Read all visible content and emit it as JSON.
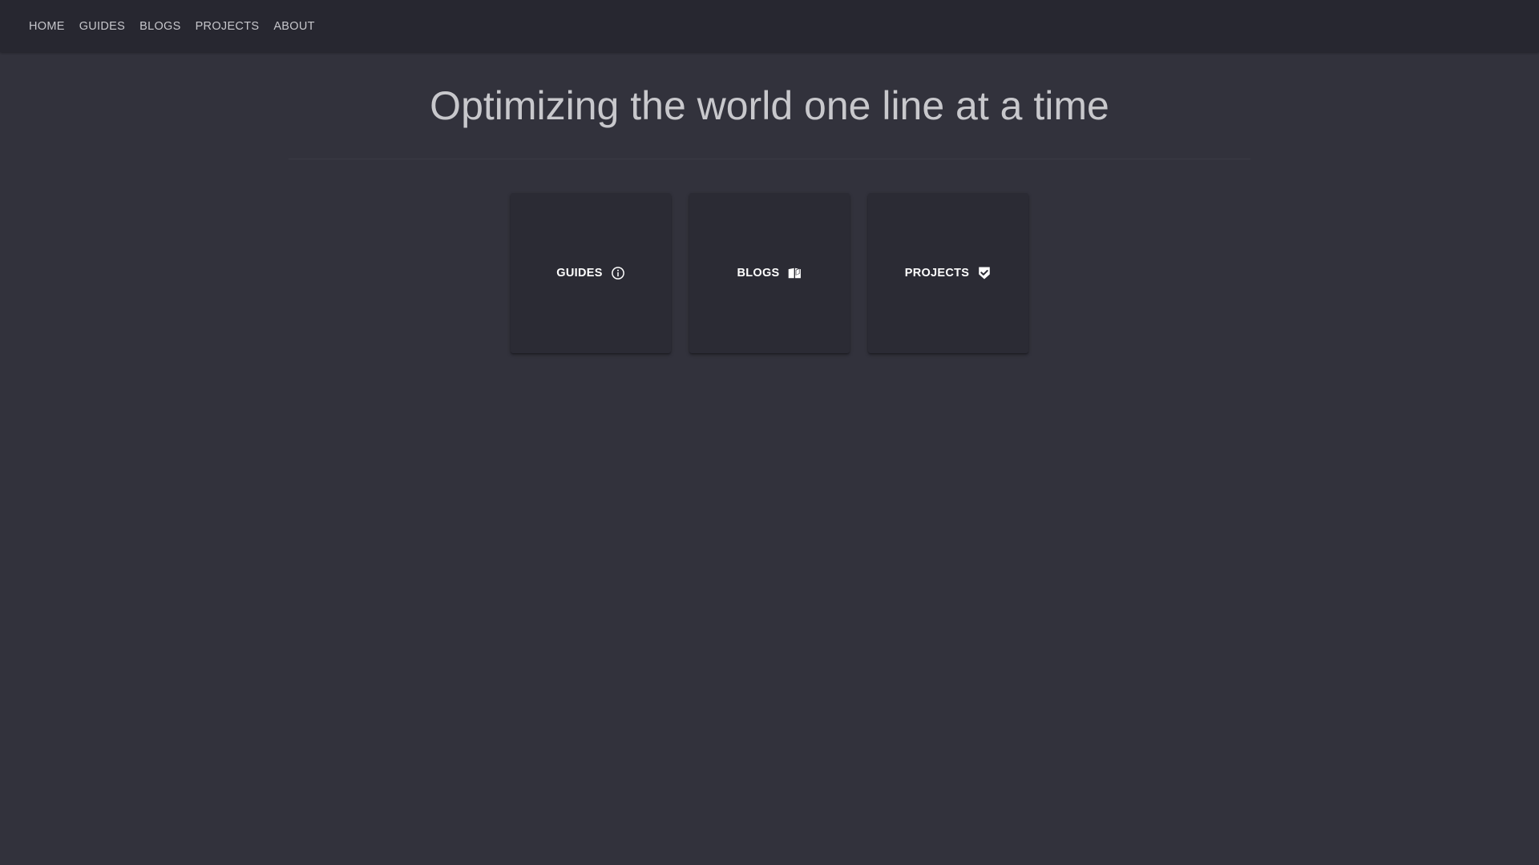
{
  "nav": {
    "items": [
      {
        "label": "HOME"
      },
      {
        "label": "GUIDES"
      },
      {
        "label": "BLOGS"
      },
      {
        "label": "PROJECTS"
      },
      {
        "label": "ABOUT"
      }
    ]
  },
  "hero": {
    "title": "Optimizing the world one line at a time"
  },
  "cards": [
    {
      "label": "GUIDES",
      "icon": "info-circle-icon"
    },
    {
      "label": "BLOGS",
      "icon": "book-open-icon"
    },
    {
      "label": "PROJECTS",
      "icon": "shield-check-icon"
    }
  ],
  "colors": {
    "background": "#32323c",
    "topbar": "#272730",
    "card": "#2b2b34",
    "text": "#c8c8cc"
  }
}
